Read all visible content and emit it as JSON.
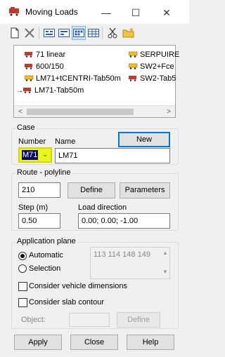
{
  "window": {
    "title": "Moving Loads",
    "minimize": "—",
    "maximize": "☐",
    "close": "✕"
  },
  "toolbar": {
    "icons": [
      "new-document-icon",
      "delete-icon",
      "view-icon-1",
      "view-icon-2",
      "view-icon-3",
      "view-icon-4",
      "cut-icon",
      "open-folder-icon"
    ]
  },
  "loads_list": {
    "items": [
      {
        "label": "71 linear",
        "icon": "train-red"
      },
      {
        "label": "SERPUIRE",
        "icon": "train-yellow"
      },
      {
        "label": "600/150",
        "icon": "train-red"
      },
      {
        "label": "SW2+Fce",
        "icon": "train-yellow"
      },
      {
        "label": "LM71+tCENTRI-Tab50m",
        "icon": "train-yellow"
      },
      {
        "label": "SW2-Tab5",
        "icon": "train-red"
      },
      {
        "label": "LM71-Tab50m",
        "icon": "train-red-arrow"
      }
    ]
  },
  "case": {
    "group_label": "Case",
    "number_label": "Number",
    "name_label": "Name",
    "new_button": "New",
    "number_value": "M71",
    "name_value": "LM71"
  },
  "route": {
    "group_label": "Route - polyline",
    "route_value": "210",
    "define_button": "Define",
    "parameters_button": "Parameters",
    "step_label": "Step (m)",
    "step_value": "0.50",
    "direction_label": "Load direction",
    "direction_value": "0.00; 0.00; -1.00"
  },
  "application_plane": {
    "group_label": "Application plane",
    "automatic_label": "Automatic",
    "selection_label": "Selection",
    "selected": "Automatic",
    "nodes_text": "113 114 148 149",
    "vehicle_dims_label": "Consider vehicle dimensions",
    "slab_contour_label": "Consider slab contour",
    "object_label": "Object:",
    "define_button": "Define"
  },
  "footer": {
    "apply": "Apply",
    "close": "Close",
    "help": "Help"
  },
  "colors": {
    "highlight": "#e8f61c",
    "selection": "#0a0a6a",
    "accent": "#0078d7"
  }
}
